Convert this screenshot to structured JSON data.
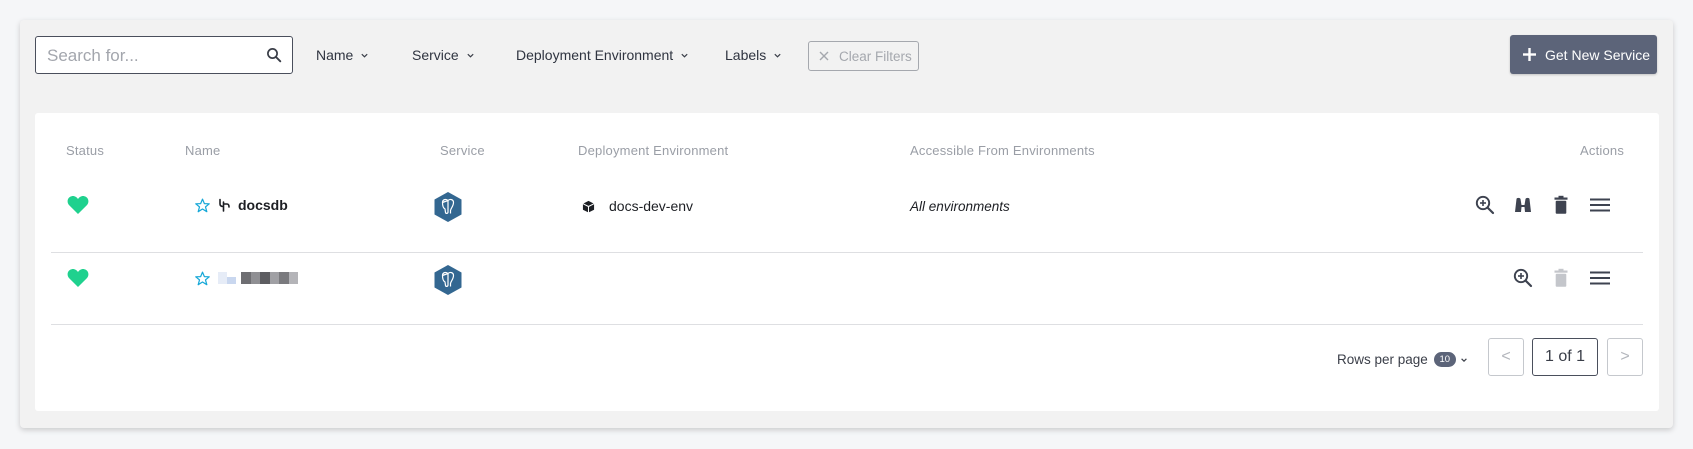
{
  "toolbar": {
    "search_placeholder": "Search for...",
    "filters": [
      "Name",
      "Service",
      "Deployment Environment",
      "Labels"
    ],
    "clear_filters_label": "Clear Filters",
    "new_service_label": "Get New Service"
  },
  "table": {
    "columns": [
      "Status",
      "Name",
      "Service",
      "Deployment Environment",
      "Accessible From Environments",
      "Actions"
    ],
    "rows": [
      {
        "status_icon": "heart-icon",
        "favorite_icon": "star-icon",
        "type_icon": "cactus-icon",
        "name": "docsdb",
        "service_icon": "postgresql-icon",
        "deployment_environment": "docs-dev-env",
        "accessible_from": "All environments",
        "actions": [
          "zoom-in-icon",
          "binoculars-icon",
          "trash-icon",
          "menu-icon"
        ]
      },
      {
        "status_icon": "heart-icon",
        "favorite_icon": "star-icon",
        "name": "",
        "name_redacted": true,
        "service_icon": "postgresql-icon",
        "deployment_environment": "",
        "accessible_from": "",
        "actions": [
          "zoom-in-icon",
          "trash-icon-disabled",
          "menu-icon"
        ]
      }
    ]
  },
  "pagination": {
    "rows_per_page_label": "Rows per page",
    "rows_per_page_value": "10",
    "page_indicator": "1 of 1",
    "prev_label": "<",
    "next_label": ">"
  },
  "colors": {
    "status_healthy": "#1fd18e",
    "star_outline": "#17a8d8",
    "service_hex": "#336791",
    "primary_button": "#5c6479"
  }
}
